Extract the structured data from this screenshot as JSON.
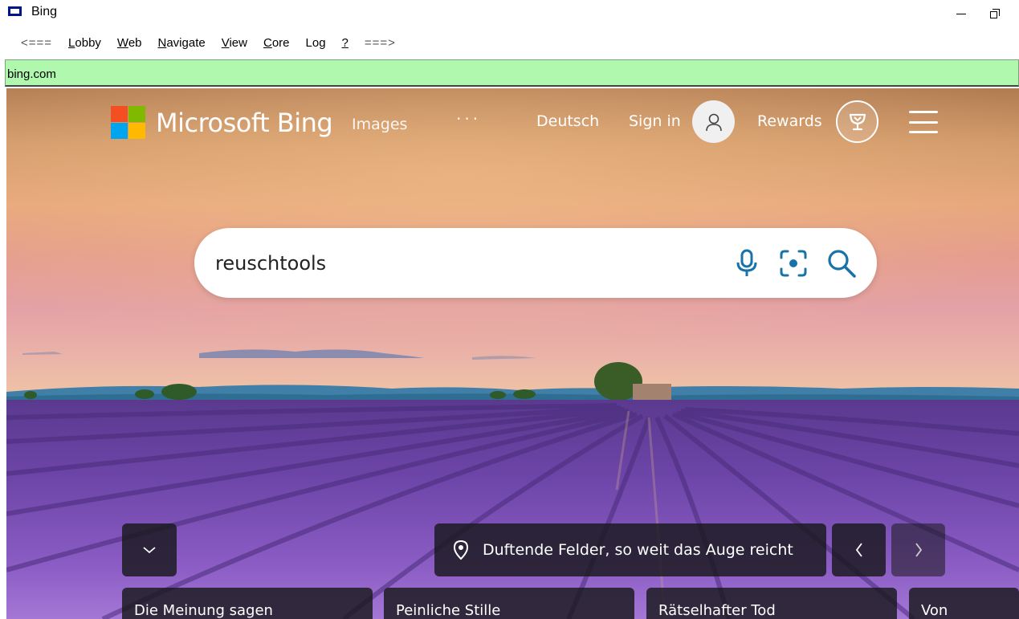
{
  "window": {
    "title": "Bing",
    "minimize_icon": "minimize-icon",
    "restore_icon": "restore-icon"
  },
  "menubar": {
    "back": "<===",
    "forward": "===>",
    "items": [
      {
        "label": "Lobby",
        "underline": "L",
        "rest": "obby"
      },
      {
        "label": "Web",
        "underline": "W",
        "rest": "eb"
      },
      {
        "label": "Navigate",
        "underline": "N",
        "rest": "avigate"
      },
      {
        "label": "View",
        "underline": "V",
        "rest": "iew"
      },
      {
        "label": "Core",
        "underline": "C",
        "rest": "ore"
      },
      {
        "label": "Log",
        "pre": "Lo",
        "underline": "g"
      },
      {
        "label": "?",
        "underline": "?"
      }
    ]
  },
  "address": {
    "value": "bing.com",
    "background": "#aff8ad"
  },
  "bing": {
    "logo_text": "Microsoft Bing",
    "logo_colors": [
      "#f25022",
      "#7fba00",
      "#00a4ef",
      "#ffb900"
    ],
    "nav": {
      "images": "Images",
      "more": "···",
      "language": "Deutsch",
      "sign_in": "Sign in",
      "rewards": "Rewards"
    },
    "search": {
      "query": "reuschtools",
      "accent": "#1a73a8"
    },
    "caption": "Duftende Felder, so weit das Auge reicht",
    "cards": [
      "Die Meinung sagen",
      "Peinliche Stille",
      "Rätselhafter Tod",
      "Von"
    ]
  }
}
